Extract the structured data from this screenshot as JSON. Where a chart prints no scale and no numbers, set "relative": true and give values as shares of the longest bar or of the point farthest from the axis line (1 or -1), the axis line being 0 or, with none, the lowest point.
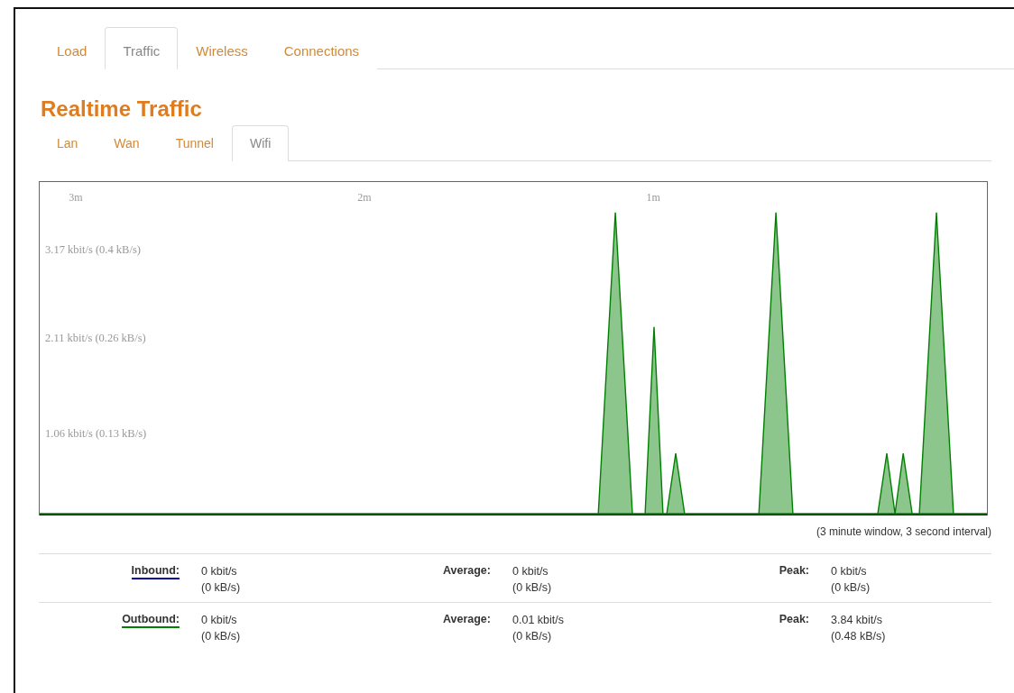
{
  "main_tabs": [
    {
      "label": "Load",
      "selected": false
    },
    {
      "label": "Traffic",
      "selected": true
    },
    {
      "label": "Wireless",
      "selected": false
    },
    {
      "label": "Connections",
      "selected": false
    }
  ],
  "title": "Realtime Traffic",
  "interface_tabs": [
    {
      "label": "Lan",
      "selected": false
    },
    {
      "label": "Wan",
      "selected": false
    },
    {
      "label": "Tunnel",
      "selected": false
    },
    {
      "label": "Wifi",
      "selected": true
    }
  ],
  "graph": {
    "chart_data": {
      "type": "area",
      "x": [
        3.125,
        1.19,
        1.131,
        1.072,
        1.028,
        0.997,
        0.966,
        0.953,
        0.922,
        0.891,
        0.634,
        0.575,
        0.516,
        0.222,
        0.191,
        0.1625,
        0.134,
        0.103,
        0.078,
        0.019,
        -0.04,
        -0.156
      ],
      "series": [
        {
          "color": "#008000",
          "values": [
            0,
            0,
            1,
            0,
            0,
            0.62,
            0,
            0,
            0.2,
            0,
            0,
            1,
            0,
            0,
            0.2,
            0,
            0.2,
            0,
            0,
            1,
            0,
            0
          ]
        }
      ],
      "xlim": [
        3.125,
        -0.156
      ],
      "relative": true,
      "xticks": [
        {
          "value": 3,
          "label": "3m"
        },
        {
          "value": 2,
          "label": "2m"
        },
        {
          "value": 1,
          "label": "1m"
        }
      ]
    },
    "rate_labels": [
      "3.17 kbit/s (0.4 kB/s)",
      "2.11 kbit/s (0.26 kB/s)",
      "1.06 kbit/s (0.13 kB/s)"
    ],
    "caption": "(3 minute window, 3 second interval)"
  },
  "stats": [
    {
      "label": "Inbound:",
      "color": "#0000aa",
      "current": [
        "0 kbit/s",
        "(0 kB/s)"
      ],
      "average_label": "Average:",
      "average": [
        "0 kbit/s",
        "(0 kB/s)"
      ],
      "peak_label": "Peak:",
      "peak": [
        "0 kbit/s",
        "(0 kB/s)"
      ]
    },
    {
      "label": "Outbound:",
      "color": "#008000",
      "current": [
        "0 kbit/s",
        "(0 kB/s)"
      ],
      "average_label": "Average:",
      "average": [
        "0.01 kbit/s",
        "(0 kB/s)"
      ],
      "peak_label": "Peak:",
      "peak": [
        "3.84 kbit/s",
        "(0.48 kB/s)"
      ]
    }
  ]
}
